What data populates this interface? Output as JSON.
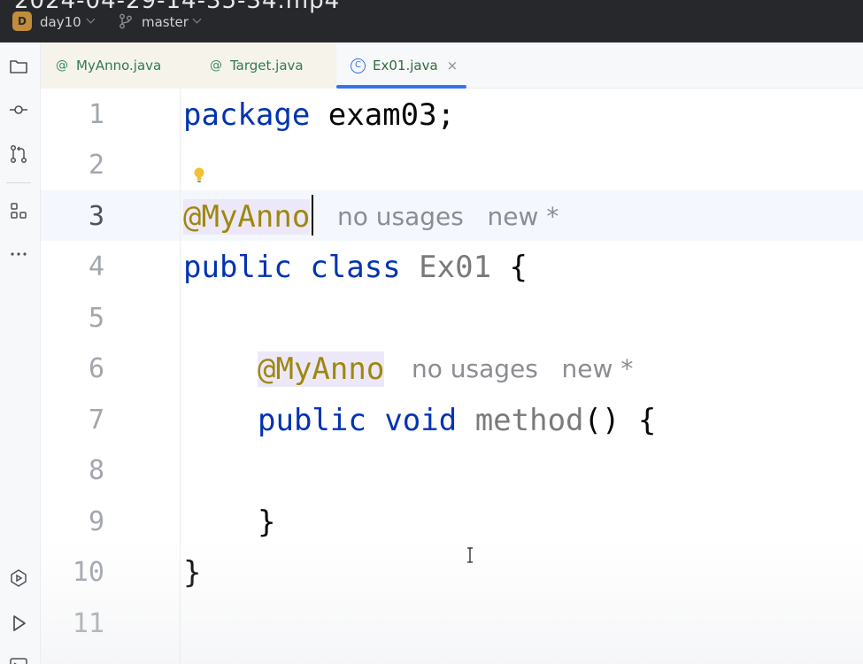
{
  "titlebar": {
    "cut_title_text": "2024-04-29-14-35-34.mp4",
    "project_badge": "D",
    "project_name": "day10",
    "branch_name": "master"
  },
  "toolstrip": {
    "icons": [
      "project-folder-icon",
      "commit-icon",
      "pull-requests-icon",
      "structure-icon",
      "more-icon",
      "services-icon",
      "run-icon",
      "terminal-icon"
    ]
  },
  "tabs": [
    {
      "label": "MyAnno.java",
      "icon": "@",
      "type": "annotation"
    },
    {
      "label": "Target.java",
      "icon": "@",
      "type": "annotation"
    },
    {
      "label": "Ex01.java",
      "icon": "C",
      "type": "class",
      "active": true,
      "close": "×"
    }
  ],
  "editor": {
    "line_numbers": [
      "1",
      "2",
      "3",
      "4",
      "5",
      "6",
      "7",
      "8",
      "9",
      "10",
      "11"
    ],
    "current_line": 3,
    "code": {
      "l1_kw": "package",
      "l1_rest": " exam03;",
      "l3_ann": "@MyAnno",
      "l3_hint": "no usages   new *",
      "l4_kw1": "public",
      "l4_kw2": "class",
      "l4_cls": "Ex01",
      "l4_brace": " {",
      "l6_ann": "@MyAnno",
      "l6_hint": "no usages   new *",
      "l7_kw1": "public",
      "l7_kw2": "void",
      "l7_fn": "method",
      "l7_rest": "() {",
      "l9": "}",
      "l10": "}"
    }
  },
  "colors": {
    "keyword": "#0033b3",
    "annotation": "#9e880d",
    "current_line_bg": "#f4f7fd",
    "tab_underline": "#3574f0"
  }
}
